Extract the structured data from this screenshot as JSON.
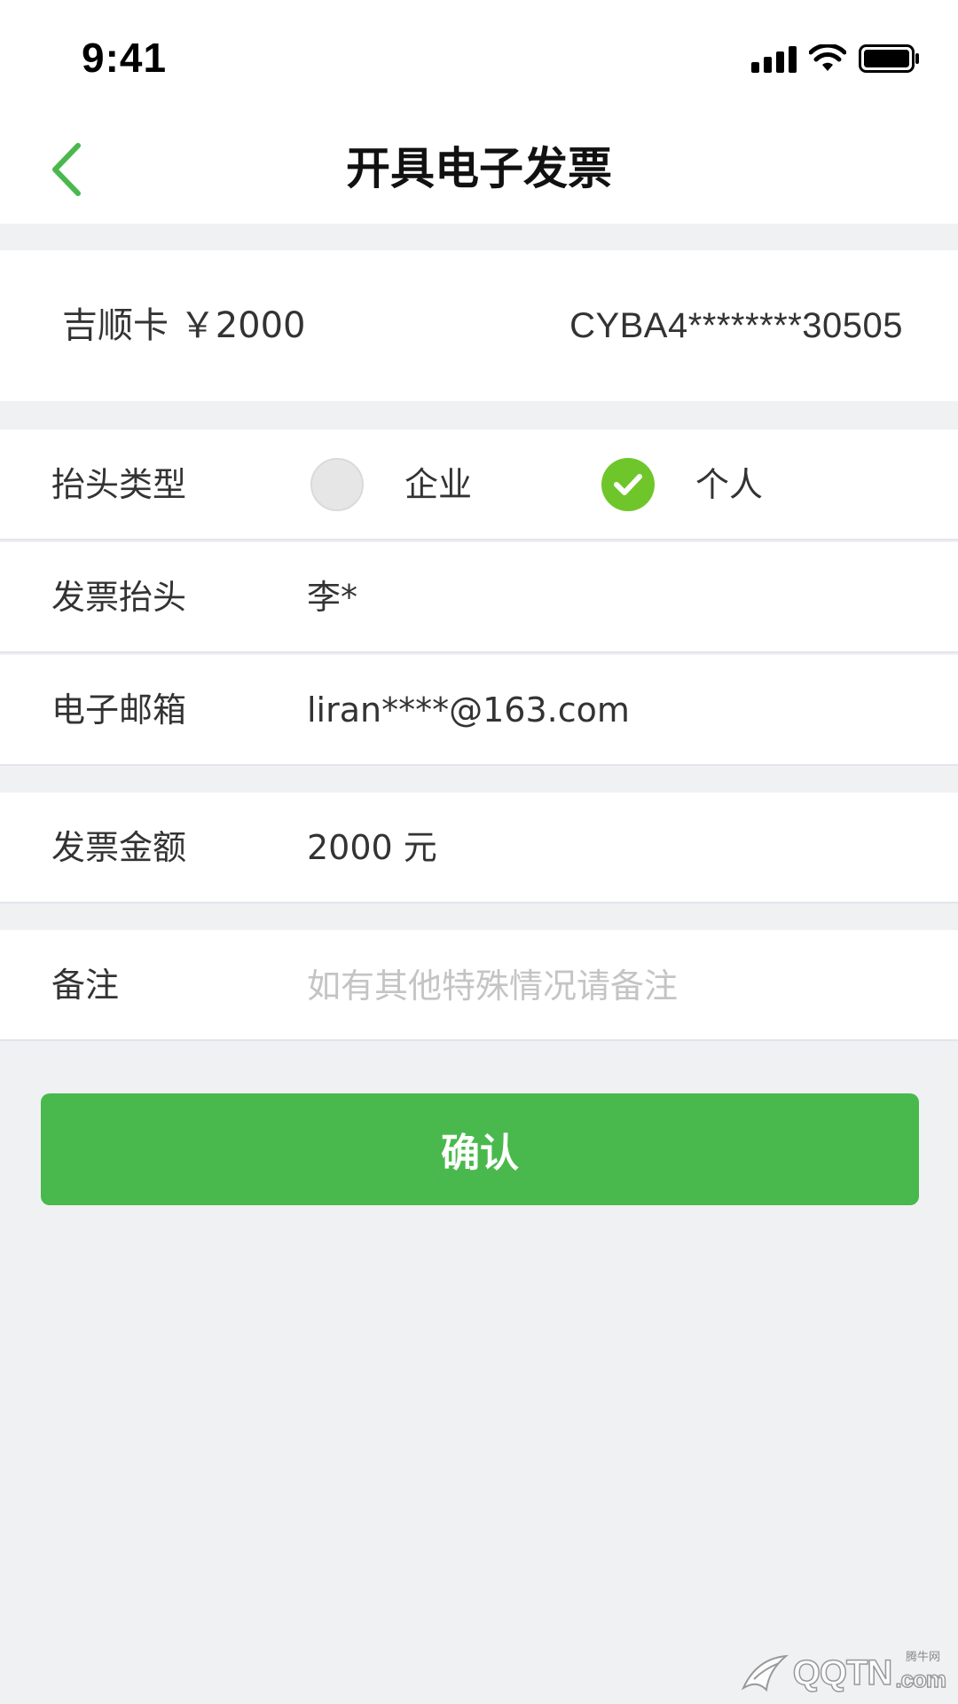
{
  "status_bar": {
    "time": "9:41"
  },
  "nav": {
    "title": "开具电子发票",
    "back_icon": "chevron-left-icon",
    "accent_color": "#4ab94d"
  },
  "card": {
    "name_amount": "吉顺卡 ￥2000",
    "number": "CYBA4********30505"
  },
  "form": {
    "title_type": {
      "label": "抬头类型",
      "options": [
        {
          "label": "企业",
          "selected": false
        },
        {
          "label": "个人",
          "selected": true
        }
      ]
    },
    "invoice_title": {
      "label": "发票抬头",
      "value": "李*"
    },
    "email": {
      "label": "电子邮箱",
      "value": "liran****@163.com"
    },
    "amount": {
      "label": "发票金额",
      "value": "2000 元"
    },
    "remark": {
      "label": "备注",
      "placeholder": "如有其他特殊情况请备注",
      "value": ""
    }
  },
  "actions": {
    "confirm_label": "确认",
    "confirm_color": "#4ab94d"
  },
  "watermark": {
    "brand": "QQTN",
    "suffix": ".com",
    "small": "腾牛网"
  }
}
